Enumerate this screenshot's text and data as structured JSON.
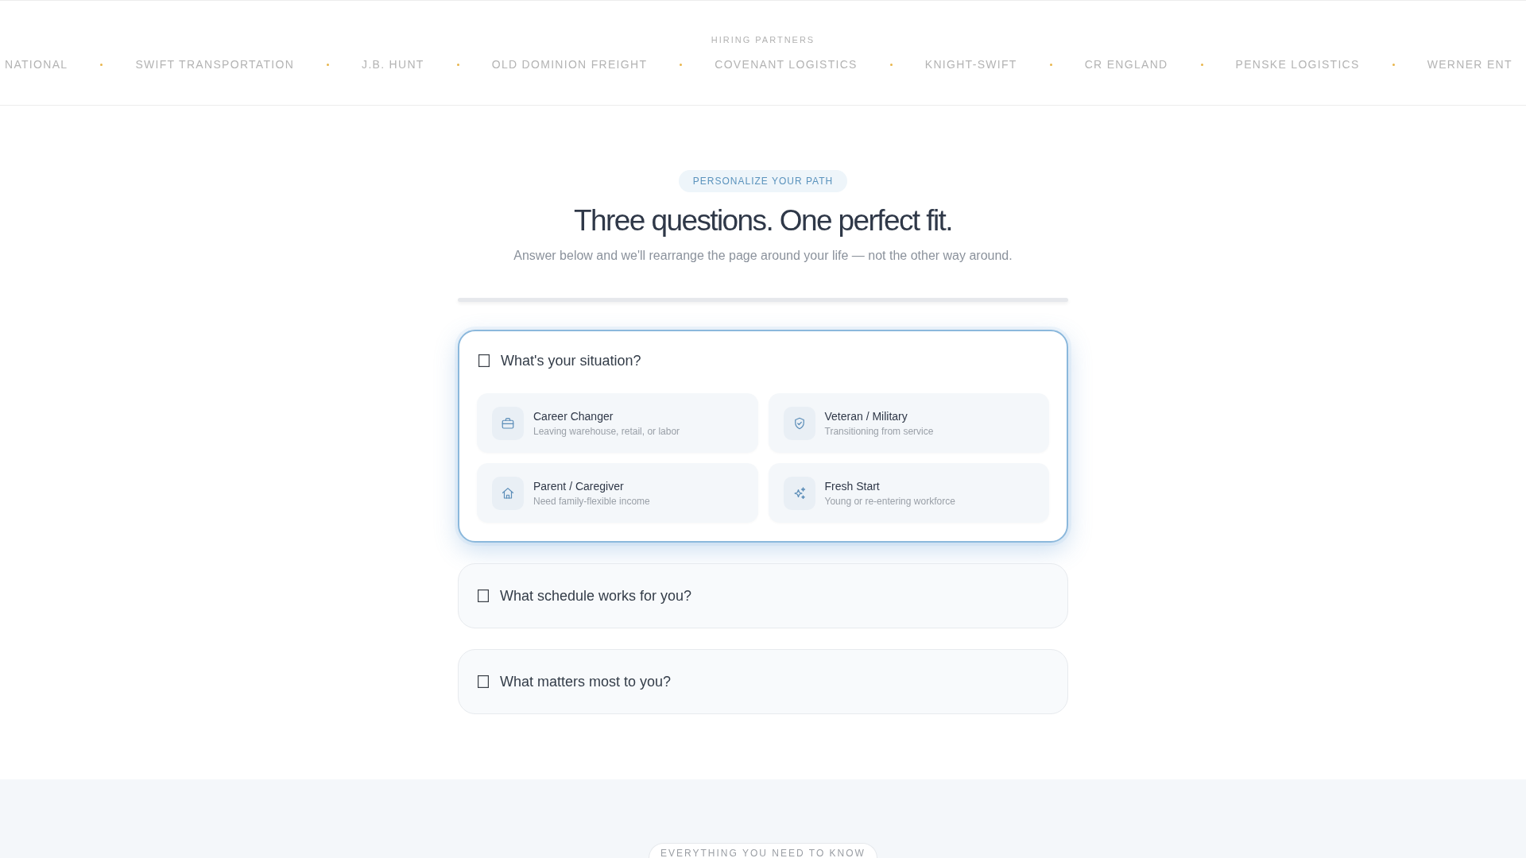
{
  "partners": {
    "label": "HIRING PARTNERS",
    "names": [
      "NATIONAL",
      "SWIFT TRANSPORTATION",
      "J.B. HUNT",
      "OLD DOMINION FREIGHT",
      "COVENANT LOGISTICS",
      "KNIGHT-SWIFT",
      "CR ENGLAND",
      "PENSKE LOGISTICS",
      "WERNER ENT"
    ]
  },
  "intro": {
    "tag": "PERSONALIZE YOUR PATH",
    "heading": "Three questions. One perfect fit.",
    "subtitle": "Answer below and we'll rearrange the page around your life — not the other way around."
  },
  "progress": {
    "level": 0
  },
  "questions": [
    {
      "title": "What's your situation?",
      "expanded": true,
      "options": [
        {
          "title": "Career Changer",
          "description": "Leaving warehouse, retail, or labor",
          "selected": false
        },
        {
          "title": "Veteran / Military",
          "description": "Transitioning from service",
          "selected": false
        },
        {
          "title": "Parent / Caregiver",
          "description": "Need family-flexible income",
          "selected": false
        },
        {
          "title": "Fresh Start",
          "description": "Young or re-entering workforce",
          "selected": false
        }
      ]
    },
    {
      "title": "What schedule works for you?",
      "expanded": false
    },
    {
      "title": "What matters most to you?",
      "expanded": false
    }
  ],
  "next_section": {
    "tag": "EVERYTHING YOU NEED TO KNOW"
  }
}
